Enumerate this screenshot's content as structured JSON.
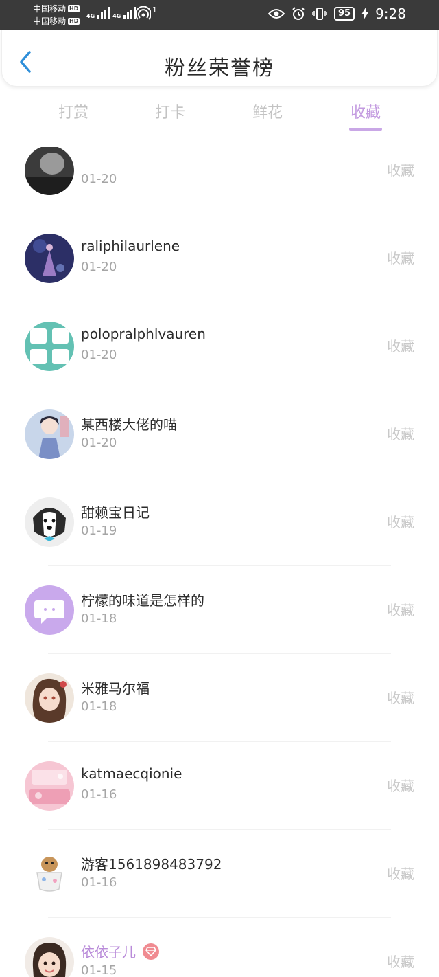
{
  "status_bar": {
    "carrier_1": "中国移动",
    "carrier_2": "中国移动",
    "hd_badge": "HD",
    "network_1": "4G",
    "network_2": "4G",
    "hotspot_count": "1",
    "battery_level": "95",
    "time": "9:28"
  },
  "header": {
    "title": "粉丝荣誉榜",
    "accent_color": "#2f8fd9"
  },
  "tabs": [
    {
      "label": "打赏"
    },
    {
      "label": "打卡"
    },
    {
      "label": "鲜花"
    },
    {
      "label": "收藏"
    }
  ],
  "active_tab": "收藏",
  "list": {
    "action_label": "收藏",
    "items": [
      {
        "name": "",
        "date": "01-20",
        "avatar": "gray-portrait"
      },
      {
        "name": "raliphilaurlene",
        "date": "01-20",
        "avatar": "purple-figure"
      },
      {
        "name": "polopralphlvauren",
        "date": "01-20",
        "avatar": "teal-text-sticker"
      },
      {
        "name": "某西楼大佬的喵",
        "date": "01-20",
        "avatar": "anime-boy"
      },
      {
        "name": "甜赖宝日记",
        "date": "01-19",
        "avatar": "husky-dog"
      },
      {
        "name": "柠檬的味道是怎样的",
        "date": "01-18",
        "avatar": "purple-chat-bubble"
      },
      {
        "name": "米雅马尔福",
        "date": "01-18",
        "avatar": "anime-girl"
      },
      {
        "name": "katmaecqionie",
        "date": "01-16",
        "avatar": "pink-room"
      },
      {
        "name": "游客1561898483792",
        "date": "01-16",
        "avatar": "kitten-in-cup"
      },
      {
        "name": "依依子儿",
        "date": "01-15",
        "avatar": "little-girl",
        "vip": true
      }
    ]
  }
}
